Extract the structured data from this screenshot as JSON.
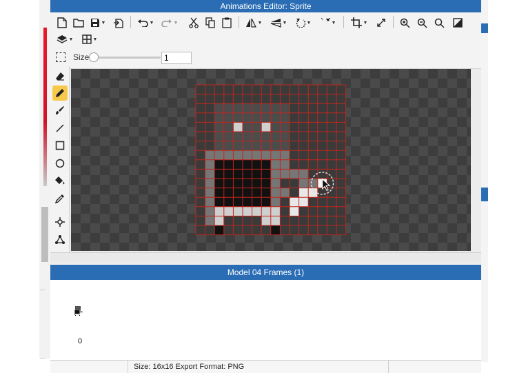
{
  "window": {
    "title": "Animations Editor: Sprite"
  },
  "toolbar": {
    "row1": [
      {
        "icon": "new-file-icon"
      },
      {
        "icon": "open-folder-icon"
      },
      {
        "icon": "save-icon"
      },
      {
        "icon": "export-icon"
      },
      {
        "icon": "undo-icon"
      },
      {
        "icon": "redo-icon"
      },
      {
        "icon": "cut-icon"
      },
      {
        "icon": "copy-icon"
      },
      {
        "icon": "paste-icon"
      },
      {
        "icon": "flip-horizontal-icon"
      },
      {
        "icon": "flip-vertical-icon"
      },
      {
        "icon": "rotate-left-icon"
      },
      {
        "icon": "rotate-right-icon"
      },
      {
        "icon": "crop-icon"
      },
      {
        "icon": "resize-icon"
      },
      {
        "icon": "zoom-in-icon"
      },
      {
        "icon": "zoom-out-icon"
      },
      {
        "icon": "zoom-fit-icon"
      },
      {
        "icon": "invert-icon"
      }
    ],
    "row2": [
      {
        "icon": "layers-icon"
      },
      {
        "icon": "grid-icon"
      }
    ],
    "brush": {
      "size_label": "Size",
      "size_value": "1",
      "size_level": 0.0
    }
  },
  "tools": [
    {
      "icon": "eraser-icon",
      "active": false
    },
    {
      "icon": "pencil-icon",
      "active": true
    },
    {
      "icon": "brush-icon",
      "active": false
    },
    {
      "icon": "line-icon",
      "active": false
    },
    {
      "icon": "rectangle-icon",
      "active": false
    },
    {
      "icon": "ellipse-icon",
      "active": false
    },
    {
      "icon": "fill-bucket-icon",
      "active": false
    },
    {
      "icon": "eyedropper-icon",
      "active": false
    },
    {
      "icon": "origin-icon",
      "active": false
    },
    {
      "icon": "attach-points-icon",
      "active": false
    }
  ],
  "sprite": {
    "cols": 16,
    "rows": 16,
    "palette": {
      "0": "transparent",
      "1": "#4c4c4c",
      "2": "#111111",
      "3": "#cfcfcf",
      "4": "#767676",
      "5": "#e8e8e8",
      "6": "#f4f4f4"
    },
    "pixels": [
      "0000000000000000",
      "0000000000000000",
      "0011111111000000",
      "0011111111000000",
      "0011311311000000",
      "0011111111000000",
      "0011111111000000",
      "0444444444000000",
      "0422222244000000",
      "0422222244440000",
      "0422222240044600",
      "0422222244055000",
      "0422222240550000",
      "0433333330500000",
      "0430000330000000",
      "0020000020000000"
    ],
    "grid_color": "#c0261c"
  },
  "frames_panel": {
    "title": "Model 04 Frames (1)",
    "frames": [
      {
        "label": "0"
      }
    ]
  },
  "statusbar": {
    "text": "Size: 16x16   Export Format: PNG"
  }
}
